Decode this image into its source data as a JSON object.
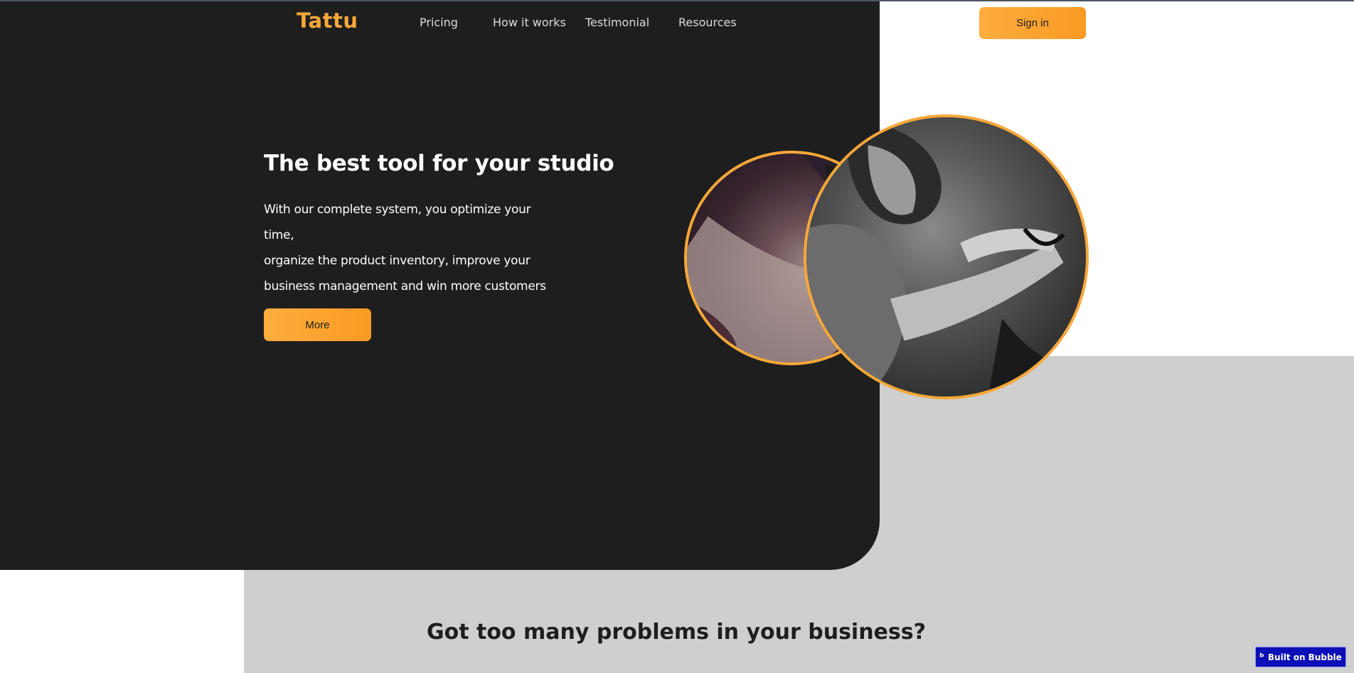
{
  "brand": {
    "logo_text": "Tattu"
  },
  "nav": {
    "items": [
      {
        "label": "Pricing"
      },
      {
        "label": "How it works"
      },
      {
        "label": "Testimonial"
      },
      {
        "label": "Resources"
      }
    ],
    "signin_label": "Sign in"
  },
  "hero": {
    "title": "The best tool for your studio",
    "text_lines": [
      "With our complete system, you optimize your time,",
      "organize the product inventory, improve your",
      "business management and win more customers"
    ],
    "cta_label": "More"
  },
  "images": {
    "small": {
      "icon": "tattoo-closeup-photo"
    },
    "large": {
      "icon": "tattoo-artist-photo"
    }
  },
  "problems": {
    "title": "Got too many problems in your business?"
  },
  "badge": {
    "label": "Built on Bubble",
    "icon": "bubble-logo-icon"
  },
  "colors": {
    "accent": "#f7a83a",
    "dark": "#1e1e1e",
    "gray": "#cfcfcf",
    "badge": "#0d0fb6"
  }
}
